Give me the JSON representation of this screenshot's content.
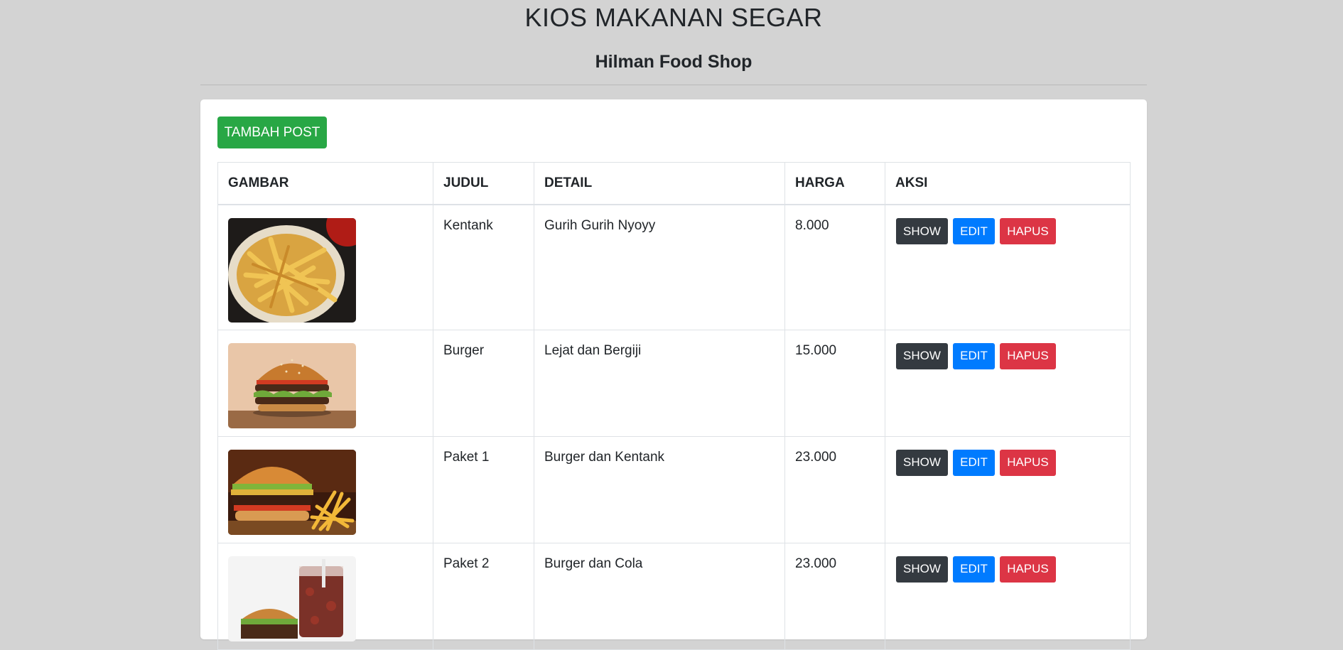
{
  "header": {
    "title": "KIOS MAKANAN SEGAR",
    "subtitle": "Hilman Food Shop"
  },
  "toolbar": {
    "add_label": "TAMBAH POST",
    "add_color": "#28a745"
  },
  "table": {
    "columns": [
      "GAMBAR",
      "JUDUL",
      "DETAIL",
      "HARGA",
      "AKSI"
    ],
    "rows": [
      {
        "image": "fries-photo",
        "judul": "Kentank",
        "detail": "Gurih Gurih Nyoyy",
        "harga": "8.000"
      },
      {
        "image": "burger-photo",
        "judul": "Burger",
        "detail": "Lejat dan Bergiji",
        "harga": "15.000"
      },
      {
        "image": "burger-fries-photo",
        "judul": "Paket 1",
        "detail": "Burger dan Kentank",
        "harga": "23.000"
      },
      {
        "image": "burger-cola-photo",
        "judul": "Paket 2",
        "detail": "Burger dan Cola",
        "harga": "23.000"
      }
    ]
  },
  "actions": {
    "show_label": "SHOW",
    "edit_label": "EDIT",
    "delete_label": "HAPUS",
    "show_color": "#343a40",
    "edit_color": "#007bff",
    "delete_color": "#dc3545"
  }
}
